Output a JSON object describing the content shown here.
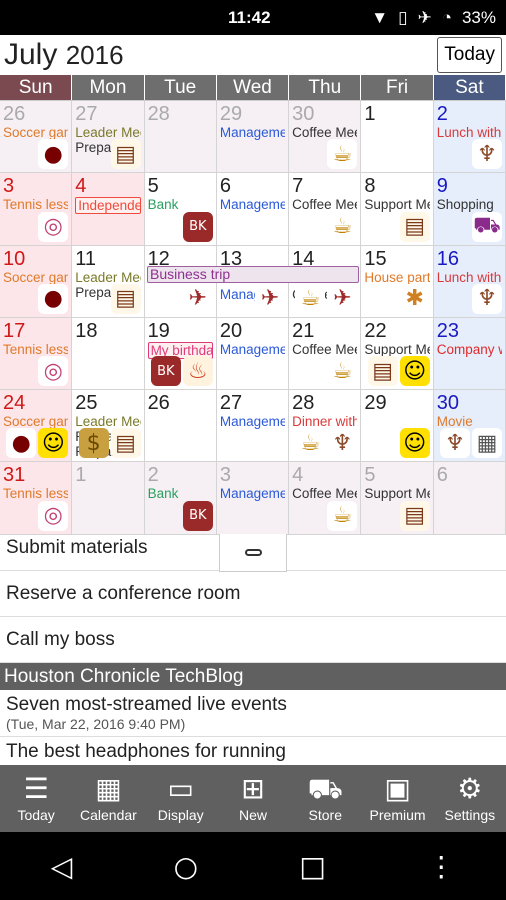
{
  "status": {
    "time": "11:42",
    "battery": "33%"
  },
  "header": {
    "month": "July",
    "year": "2016",
    "today_button": "Today"
  },
  "weekdays": [
    {
      "label": "Sun",
      "color": "#7a4a50"
    },
    {
      "label": "Mon",
      "color": "#6e6e6e"
    },
    {
      "label": "Tue",
      "color": "#6e6e6e"
    },
    {
      "label": "Wed",
      "color": "#6e6e6e"
    },
    {
      "label": "Thu",
      "color": "#6e6e6e"
    },
    {
      "label": "Fri",
      "color": "#6e6e6e"
    },
    {
      "label": "Sat",
      "color": "#4a5a80"
    }
  ],
  "span_event": {
    "text": "Business trip"
  },
  "weeks": [
    [
      {
        "n": "26",
        "o": 1,
        "ev": [
          {
            "t": "Soccer game",
            "c": "#e07a2a"
          }
        ],
        "ic": [
          "soccer"
        ]
      },
      {
        "n": "27",
        "o": 1,
        "ev": [
          {
            "t": "Leader Meeting",
            "c": "#7a7a2a"
          },
          {
            "t": "Preparation",
            "c": "#333"
          }
        ],
        "ic": [
          "book"
        ]
      },
      {
        "n": "28",
        "o": 1,
        "ev": [],
        "ic": []
      },
      {
        "n": "29",
        "o": 1,
        "ev": [
          {
            "t": "Management",
            "c": "#2a5ad8"
          }
        ],
        "ic": []
      },
      {
        "n": "30",
        "o": 1,
        "ev": [
          {
            "t": "Coffee Meeting",
            "c": "#333"
          }
        ],
        "ic": [
          "coffee"
        ]
      },
      {
        "n": "1",
        "ev": [],
        "ic": []
      },
      {
        "n": "2",
        "ev": [
          {
            "t": "Lunch with",
            "c": "#d83a3a"
          }
        ],
        "ic": [
          "cutlery"
        ]
      }
    ],
    [
      {
        "n": "3",
        "ev": [
          {
            "t": "Tennis lesson",
            "c": "#e07a2a"
          }
        ],
        "ic": [
          "tennis"
        ]
      },
      {
        "n": "4",
        "hol": 1,
        "ev": [
          {
            "t": "Independence Day",
            "c": "#f04a3a",
            "box": 1
          }
        ],
        "ic": []
      },
      {
        "n": "5",
        "ev": [
          {
            "t": "Bank",
            "c": "#2aa060"
          }
        ],
        "ic": [
          "bank"
        ]
      },
      {
        "n": "6",
        "ev": [
          {
            "t": "Management",
            "c": "#2a5ad8"
          }
        ],
        "ic": []
      },
      {
        "n": "7",
        "ev": [
          {
            "t": "Coffee Meeting",
            "c": "#333"
          }
        ],
        "ic": [
          "coffee"
        ]
      },
      {
        "n": "8",
        "ev": [
          {
            "t": "Support Meeting",
            "c": "#333"
          }
        ],
        "ic": [
          "book"
        ]
      },
      {
        "n": "9",
        "ev": [
          {
            "t": "Shopping",
            "c": "#333"
          }
        ],
        "ic": [
          "cart"
        ]
      }
    ],
    [
      {
        "n": "10",
        "ev": [
          {
            "t": "Soccer game",
            "c": "#e07a2a"
          }
        ],
        "ic": [
          "soccer"
        ]
      },
      {
        "n": "11",
        "ev": [
          {
            "t": "Leader Meeting",
            "c": "#7a7a2a"
          },
          {
            "t": "Preparation",
            "c": "#333"
          }
        ],
        "ic": [
          "book"
        ]
      },
      {
        "n": "12",
        "ev": [],
        "ic": [
          "plane"
        ],
        "sp": 1
      },
      {
        "n": "13",
        "ev": [
          {
            "t": "Management",
            "c": "#2a5ad8"
          }
        ],
        "ic": [
          "plane"
        ],
        "sp": 1
      },
      {
        "n": "14",
        "ev": [
          {
            "t": "Coffee Meeting",
            "c": "#333"
          }
        ],
        "ic": [
          "coffee",
          "plane"
        ],
        "sp": 1
      },
      {
        "n": "15",
        "ev": [
          {
            "t": "House party",
            "c": "#e07a2a"
          }
        ],
        "ic": [
          "party"
        ]
      },
      {
        "n": "16",
        "ev": [
          {
            "t": "Lunch with",
            "c": "#d83a3a"
          }
        ],
        "ic": [
          "cutlery"
        ]
      }
    ],
    [
      {
        "n": "17",
        "ev": [
          {
            "t": "Tennis lesson",
            "c": "#e07a2a"
          }
        ],
        "ic": [
          "tennis"
        ]
      },
      {
        "n": "18",
        "ev": [],
        "ic": []
      },
      {
        "n": "19",
        "ev": [
          {
            "t": "My birthday",
            "c": "#e03a7a",
            "box": 1
          }
        ],
        "ic": [
          "bank",
          "cake"
        ]
      },
      {
        "n": "20",
        "ev": [
          {
            "t": "Management",
            "c": "#2a5ad8"
          }
        ],
        "ic": []
      },
      {
        "n": "21",
        "ev": [
          {
            "t": "Coffee Meeting",
            "c": "#333"
          }
        ],
        "ic": [
          "coffee"
        ]
      },
      {
        "n": "22",
        "ev": [
          {
            "t": "Support Meeting",
            "c": "#333"
          }
        ],
        "ic": [
          "book",
          "smile"
        ]
      },
      {
        "n": "23",
        "ev": [
          {
            "t": "Company w",
            "c": "#e02a2a"
          }
        ],
        "ic": []
      }
    ],
    [
      {
        "n": "24",
        "ev": [
          {
            "t": "Soccer game",
            "c": "#e07a2a"
          }
        ],
        "ic": [
          "soccer",
          "smile"
        ]
      },
      {
        "n": "25",
        "ev": [
          {
            "t": "Leader Meeting",
            "c": "#7a7a2a"
          },
          {
            "t": "Payday",
            "c": "#333"
          },
          {
            "t": "Preparation",
            "c": "#333"
          }
        ],
        "ic": [
          "money",
          "book"
        ]
      },
      {
        "n": "26",
        "ev": [],
        "ic": []
      },
      {
        "n": "27",
        "ev": [
          {
            "t": "Management",
            "c": "#2a5ad8"
          }
        ],
        "ic": []
      },
      {
        "n": "28",
        "ev": [
          {
            "t": "Dinner with",
            "c": "#d83a3a"
          }
        ],
        "ic": [
          "coffee",
          "cutlery"
        ]
      },
      {
        "n": "29",
        "ev": [],
        "ic": [
          "smile"
        ]
      },
      {
        "n": "30",
        "ev": [
          {
            "t": "Movie",
            "c": "#e07a2a"
          }
        ],
        "ic": [
          "cutlery",
          "movie"
        ]
      }
    ],
    [
      {
        "n": "31",
        "ev": [
          {
            "t": "Tennis lesson",
            "c": "#e07a2a"
          }
        ],
        "ic": [
          "tennis"
        ]
      },
      {
        "n": "1",
        "o": 1,
        "ev": [],
        "ic": []
      },
      {
        "n": "2",
        "o": 1,
        "ev": [
          {
            "t": "Bank",
            "c": "#2aa060"
          }
        ],
        "ic": [
          "bank"
        ]
      },
      {
        "n": "3",
        "o": 1,
        "ev": [
          {
            "t": "Management",
            "c": "#2a5ad8"
          }
        ],
        "ic": []
      },
      {
        "n": "4",
        "o": 1,
        "ev": [
          {
            "t": "Coffee Meeting",
            "c": "#333"
          }
        ],
        "ic": [
          "coffee"
        ]
      },
      {
        "n": "5",
        "o": 1,
        "ev": [
          {
            "t": "Support Meeting",
            "c": "#333"
          }
        ],
        "ic": [
          "book"
        ]
      },
      {
        "n": "6",
        "o": 1,
        "ev": [],
        "ic": []
      }
    ]
  ],
  "tasks": [
    "Submit materials",
    "Reserve a conference room",
    "Call my boss"
  ],
  "feed": {
    "title": "Houston Chronicle TechBlog",
    "items": [
      {
        "title": "Seven most-streamed live events",
        "date": "(Tue, Mar 22, 2016 9:40 PM)"
      },
      {
        "title": "The best headphones for running",
        "date": ""
      }
    ]
  },
  "toolbar": [
    {
      "label": "Today",
      "icon": "menu-icon"
    },
    {
      "label": "Calendar",
      "icon": "calendar-icon"
    },
    {
      "label": "Display",
      "icon": "monitor-icon"
    },
    {
      "label": "New",
      "icon": "plus-icon"
    },
    {
      "label": "Store",
      "icon": "cart-icon"
    },
    {
      "label": "Premium",
      "icon": "jorte-book-icon"
    },
    {
      "label": "Settings",
      "icon": "gear-icon"
    }
  ]
}
